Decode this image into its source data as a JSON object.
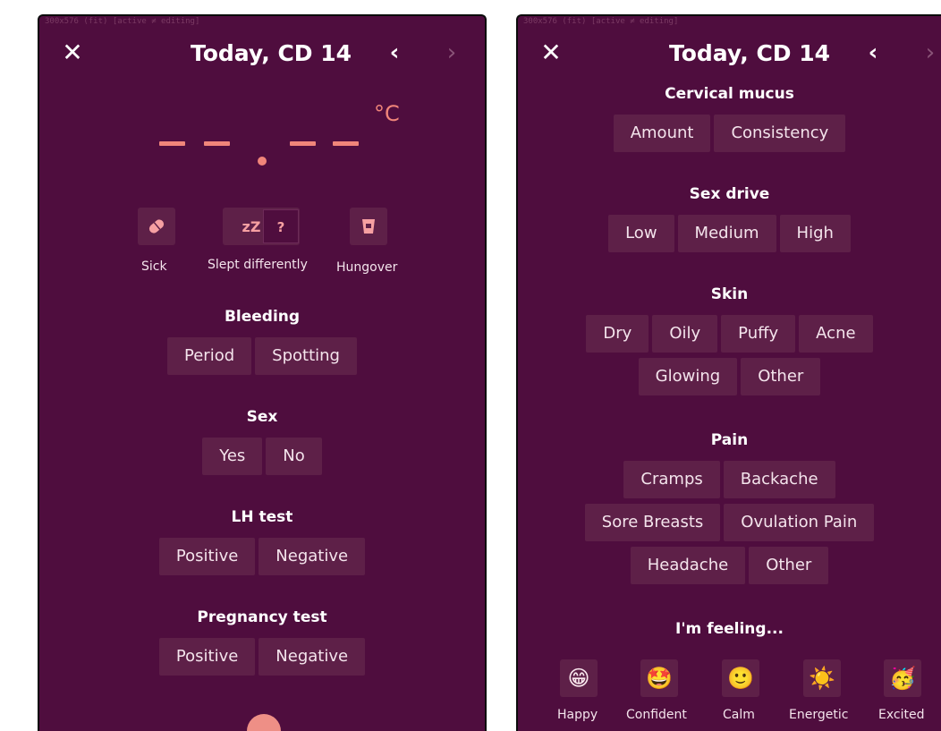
{
  "debug_text": "300x576 (fit)    [active ≠ editing]",
  "header": {
    "close_glyph": "✕",
    "title": "Today, CD 14",
    "prev_glyph": "‹",
    "next_glyph": "›"
  },
  "temperature": {
    "unit": "°C"
  },
  "quick_items": [
    {
      "icon": "pill-icon",
      "label": "Sick"
    },
    {
      "icon": "sleep-icon",
      "label": "Slept differently",
      "extra": "?"
    },
    {
      "icon": "glass-icon",
      "label": "Hungover"
    }
  ],
  "sleep_icon_text": "zZ",
  "left": {
    "bleeding": {
      "title": "Bleeding",
      "options": [
        "Period",
        "Spotting"
      ]
    },
    "sex": {
      "title": "Sex",
      "options": [
        "Yes",
        "No"
      ]
    },
    "lh_test": {
      "title": "LH test",
      "options": [
        "Positive",
        "Negative"
      ]
    },
    "pregnancy_test": {
      "title": "Pregnancy test",
      "options": [
        "Positive",
        "Negative"
      ]
    }
  },
  "right": {
    "cervical_mucus": {
      "title": "Cervical mucus",
      "options": [
        "Amount",
        "Consistency"
      ]
    },
    "sex_drive": {
      "title": "Sex drive",
      "options": [
        "Low",
        "Medium",
        "High"
      ]
    },
    "skin": {
      "title": "Skin",
      "row1": [
        "Dry",
        "Oily",
        "Puffy",
        "Acne"
      ],
      "row2": [
        "Glowing",
        "Other"
      ]
    },
    "pain": {
      "title": "Pain",
      "row1": [
        "Cramps",
        "Backache"
      ],
      "row2": [
        "Sore Breasts",
        "Ovulation Pain"
      ],
      "row3": [
        "Headache",
        "Other"
      ]
    },
    "feeling": {
      "title": "I'm feeling...",
      "items": [
        {
          "emoji": "😁",
          "label": "Happy"
        },
        {
          "emoji": "🤩",
          "label": "Confident"
        },
        {
          "emoji": "🙂",
          "label": "Calm"
        },
        {
          "emoji": "☀️",
          "label": "Energetic"
        },
        {
          "emoji": "🥳",
          "label": "Excited"
        }
      ]
    }
  }
}
